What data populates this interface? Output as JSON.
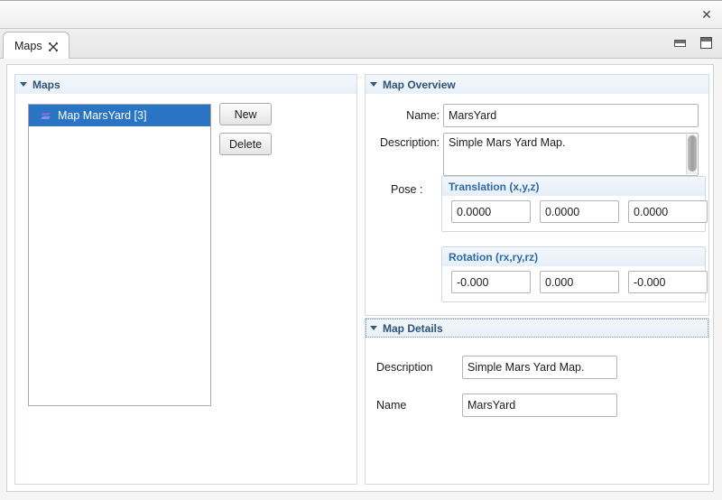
{
  "window": {
    "close_label": "✕"
  },
  "tabbar": {
    "tab_label": "Maps",
    "tab_close_icon": "close-icon",
    "minimize_icon": "minimize-icon",
    "maximize_icon": "maximize-icon"
  },
  "maps_panel": {
    "title": "Maps",
    "items": [
      {
        "label": "Map MarsYard [3]",
        "icon": "map-layer-icon",
        "selected": true
      }
    ],
    "buttons": {
      "new": "New",
      "delete": "Delete"
    }
  },
  "overview": {
    "title": "Map Overview",
    "name_label": "Name:",
    "name_value": "MarsYard",
    "description_label": "Description:",
    "description_value": "Simple Mars Yard Map.",
    "pose_label": "Pose :",
    "translation": {
      "title": "Translation (x,y,z)",
      "x": "0.0000",
      "y": "0.0000",
      "z": "0.0000"
    },
    "rotation": {
      "title": "Rotation (rx,ry,rz)",
      "rx": "-0.000",
      "ry": "0.000",
      "rz": "-0.000"
    }
  },
  "details": {
    "title": "Map Details",
    "rows": [
      {
        "label": "Description",
        "value": "Simple Mars Yard Map."
      },
      {
        "label": "Name",
        "value": "MarsYard"
      }
    ]
  },
  "colors": {
    "selection_blue": "#2a74c4",
    "section_title": "#2e5378",
    "subgroup_title": "#2d6ba8"
  }
}
